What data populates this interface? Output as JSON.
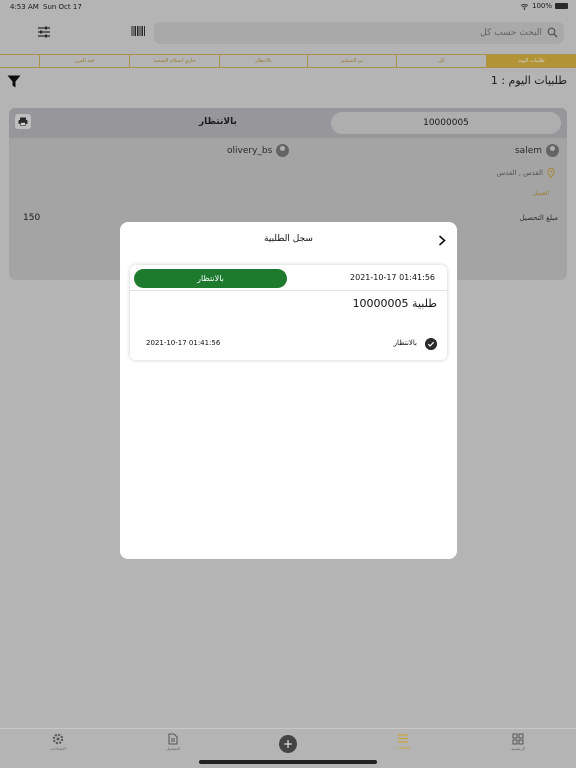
{
  "status_bar": {
    "time": "4:53 AM",
    "date": "Sun Oct 17",
    "battery": "100%"
  },
  "search": {
    "placeholder": "البحث حسب كل"
  },
  "tabs": [
    {
      "label": "طلبيات اليوم",
      "active": true
    },
    {
      "label": "كل",
      "active": false
    },
    {
      "label": "تم التسليم",
      "active": false
    },
    {
      "label": "بالانتظار",
      "active": false
    },
    {
      "label": "جاري استلام الشحنة",
      "active": false
    },
    {
      "label": "قيد الفرز",
      "active": false
    }
  ],
  "today_heading": "طلبيات اليوم : 1",
  "order_card": {
    "order_number": "10000005",
    "state": "بالانتظار",
    "customer": "salem",
    "driver": "olivery_bs",
    "city": "القدس , القدس",
    "tag": "العميل",
    "amount_label": "مبلغ التحصيل",
    "amount": "150",
    "cancelled_tag": "ملغاة"
  },
  "modal": {
    "title": "سجل الطلبية",
    "status_label": "بالانتظار",
    "date": "2021-10-17 01:41:56",
    "order_label": "طلبية 10000005",
    "step_date": "2021-10-17 01:41:56",
    "step_state": "بالانتظار"
  },
  "bottom_nav": [
    {
      "label": "الإعدادات",
      "icon": "gear-icon"
    },
    {
      "label": "التحصيل",
      "icon": "document-icon"
    },
    {
      "label": "الطلبيات",
      "icon": "list-icon",
      "active": true
    },
    {
      "label": "الرئيسية",
      "icon": "grid-icon"
    }
  ],
  "colors": {
    "accent": "#d9b542",
    "status_green": "#1e7a2e"
  }
}
